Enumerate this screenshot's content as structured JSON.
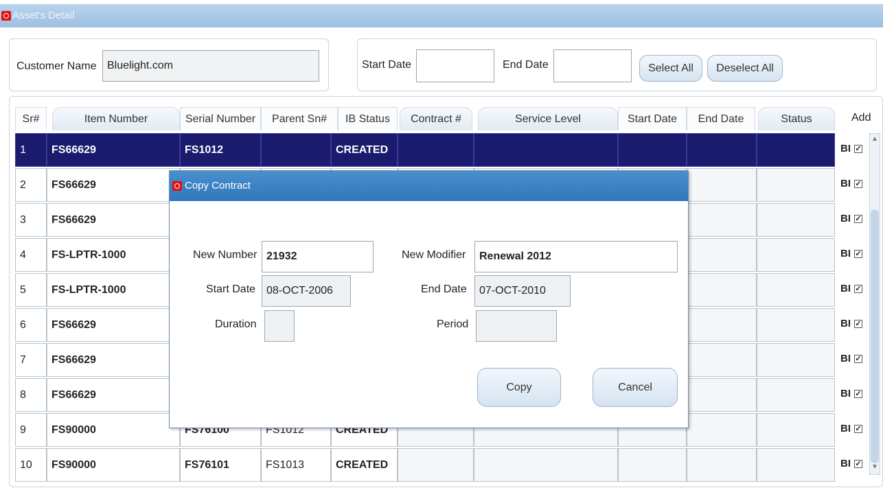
{
  "window": {
    "title": "Asset's Detail"
  },
  "header": {
    "customer_name_label": "Customer Name",
    "customer_name_value": "Bluelight.com",
    "start_date_label": "Start Date",
    "start_date_value": "",
    "end_date_label": "End Date",
    "end_date_value": "",
    "select_all_label": "Select All",
    "deselect_all_label": "Deselect All"
  },
  "table": {
    "columns": {
      "sr": "Sr#",
      "item": "Item Number",
      "serial": "Serial Number",
      "parent": "Parent Sn#",
      "ib_status": "IB Status",
      "contract": "Contract #",
      "service": "Service Level",
      "start": "Start Date",
      "end": "End Date",
      "status": "Status",
      "add": "Add"
    },
    "bl_text": "BI",
    "rows": [
      {
        "sr": "1",
        "item": "FS66629",
        "serial": "FS1012",
        "parent": "",
        "ib": "CREATED"
      },
      {
        "sr": "2",
        "item": "FS66629",
        "serial": "",
        "parent": "",
        "ib": ""
      },
      {
        "sr": "3",
        "item": "FS66629",
        "serial": "",
        "parent": "",
        "ib": ""
      },
      {
        "sr": "4",
        "item": "FS-LPTR-1000",
        "serial": "",
        "parent": "",
        "ib": ""
      },
      {
        "sr": "5",
        "item": "FS-LPTR-1000",
        "serial": "",
        "parent": "",
        "ib": ""
      },
      {
        "sr": "6",
        "item": "FS66629",
        "serial": "",
        "parent": "",
        "ib": ""
      },
      {
        "sr": "7",
        "item": "FS66629",
        "serial": "",
        "parent": "",
        "ib": ""
      },
      {
        "sr": "8",
        "item": "FS66629",
        "serial": "",
        "parent": "",
        "ib": ""
      },
      {
        "sr": "9",
        "item": "FS90000",
        "serial": "FS76100",
        "parent": "FS1012",
        "ib": "CREATED"
      },
      {
        "sr": "10",
        "item": "FS90000",
        "serial": "FS76101",
        "parent": "FS1013",
        "ib": "CREATED"
      }
    ]
  },
  "dialog": {
    "title": "Copy Contract",
    "new_number_label": "New Number",
    "new_number_value": "21932",
    "new_modifier_label": "New Modifier",
    "new_modifier_value": "Renewal 2012",
    "start_date_label": "Start Date",
    "start_date_value": "08-OCT-2006",
    "end_date_label": "End Date",
    "end_date_value": "07-OCT-2010",
    "duration_label": "Duration",
    "duration_value": "",
    "period_label": "Period",
    "period_value": "",
    "copy_label": "Copy",
    "cancel_label": "Cancel"
  }
}
